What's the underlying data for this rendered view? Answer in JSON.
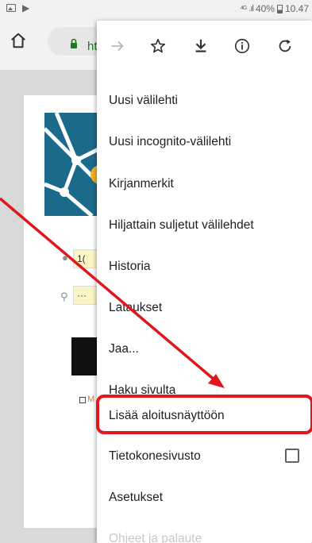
{
  "status_bar": {
    "network": "4G",
    "battery": "40%",
    "time": "10.47"
  },
  "toolbar": {
    "url_partial": "ht"
  },
  "page": {
    "username_partial": "1(",
    "password_partial": "···",
    "remember_partial": "M"
  },
  "menu": {
    "icons": [
      "forward-icon",
      "star-icon",
      "download-icon",
      "info-icon",
      "refresh-icon"
    ],
    "items": [
      {
        "label": "Uusi välilehti"
      },
      {
        "label": "Uusi incognito-välilehti"
      },
      {
        "label": "Kirjanmerkit"
      },
      {
        "label": "Hiljattain suljetut välilehdet"
      },
      {
        "label": "Historia"
      },
      {
        "label": "Lataukset"
      },
      {
        "label": "Jaa..."
      },
      {
        "label": "Haku sivulta"
      },
      {
        "label": "Lisää aloitusnäyttöön"
      },
      {
        "label": "Tietokonesivusto"
      },
      {
        "label": "Asetukset"
      },
      {
        "label": "Ohjeet ja palaute"
      }
    ],
    "highlighted_index": 8
  },
  "colors": {
    "annotation": "#e0161d",
    "secure_green": "#1e7a1e",
    "logo_blue": "#1c6a8a"
  }
}
